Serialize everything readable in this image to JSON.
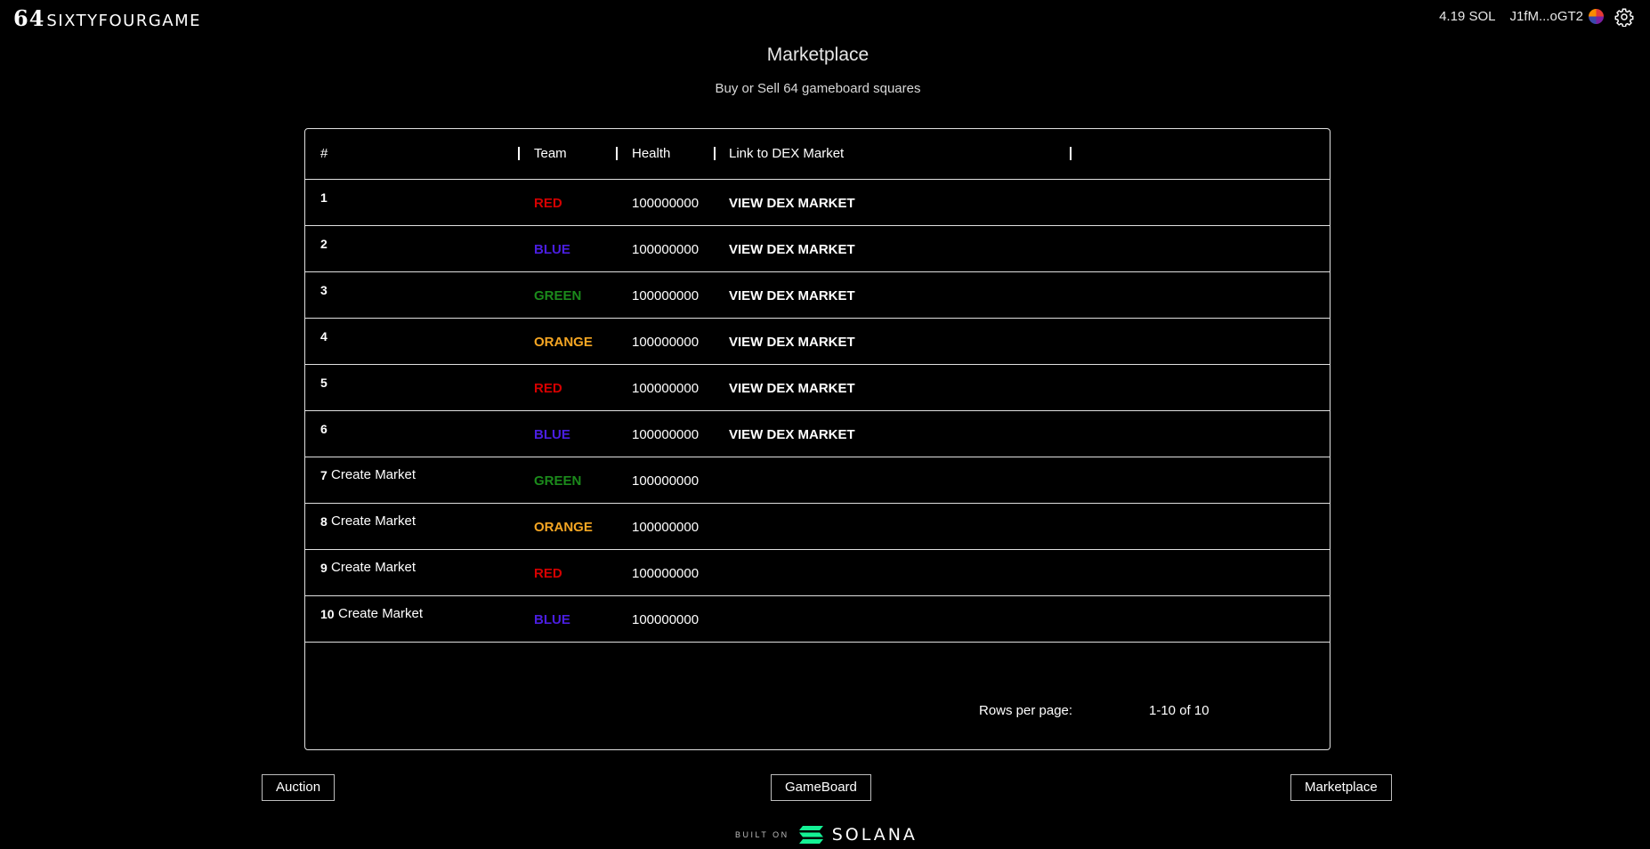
{
  "header": {
    "logo_number": "64",
    "logo_text": "SIXTYFOURGAME",
    "balance": "4.19 SOL",
    "wallet_address": "J1fM...oGT2",
    "settings_icon": "gear-icon"
  },
  "page": {
    "title": "Marketplace",
    "subtitle": "Buy or Sell 64 gameboard squares"
  },
  "table": {
    "columns": [
      "#",
      "Team",
      "Health",
      "Link to DEX Market"
    ],
    "rows": [
      {
        "num": "1",
        "create": "",
        "team": "RED",
        "health": "100000000",
        "link": "VIEW DEX MARKET"
      },
      {
        "num": "2",
        "create": "",
        "team": "BLUE",
        "health": "100000000",
        "link": "VIEW DEX MARKET"
      },
      {
        "num": "3",
        "create": "",
        "team": "GREEN",
        "health": "100000000",
        "link": "VIEW DEX MARKET"
      },
      {
        "num": "4",
        "create": "",
        "team": "ORANGE",
        "health": "100000000",
        "link": "VIEW DEX MARKET"
      },
      {
        "num": "5",
        "create": "",
        "team": "RED",
        "health": "100000000",
        "link": "VIEW DEX MARKET"
      },
      {
        "num": "6",
        "create": "",
        "team": "BLUE",
        "health": "100000000",
        "link": "VIEW DEX MARKET"
      },
      {
        "num": "7",
        "create": "Create Market",
        "team": "GREEN",
        "health": "100000000",
        "link": ""
      },
      {
        "num": "8",
        "create": "Create Market",
        "team": "ORANGE",
        "health": "100000000",
        "link": ""
      },
      {
        "num": "9",
        "create": "Create Market",
        "team": "RED",
        "health": "100000000",
        "link": ""
      },
      {
        "num": "10",
        "create": "Create Market",
        "team": "BLUE",
        "health": "100000000",
        "link": ""
      }
    ],
    "rows_per_page_label": "Rows per page:",
    "page_range": "1-10 of 10"
  },
  "team_colors": {
    "RED": "#d50000",
    "BLUE": "#4a1ee0",
    "GREEN": "#1b8a1b",
    "ORANGE": "#f5a623"
  },
  "nav": {
    "auction": "Auction",
    "gameboard": "GameBoard",
    "marketplace": "Marketplace"
  },
  "footer": {
    "built_on": "BUILT ON",
    "brand": "SOLANA"
  }
}
